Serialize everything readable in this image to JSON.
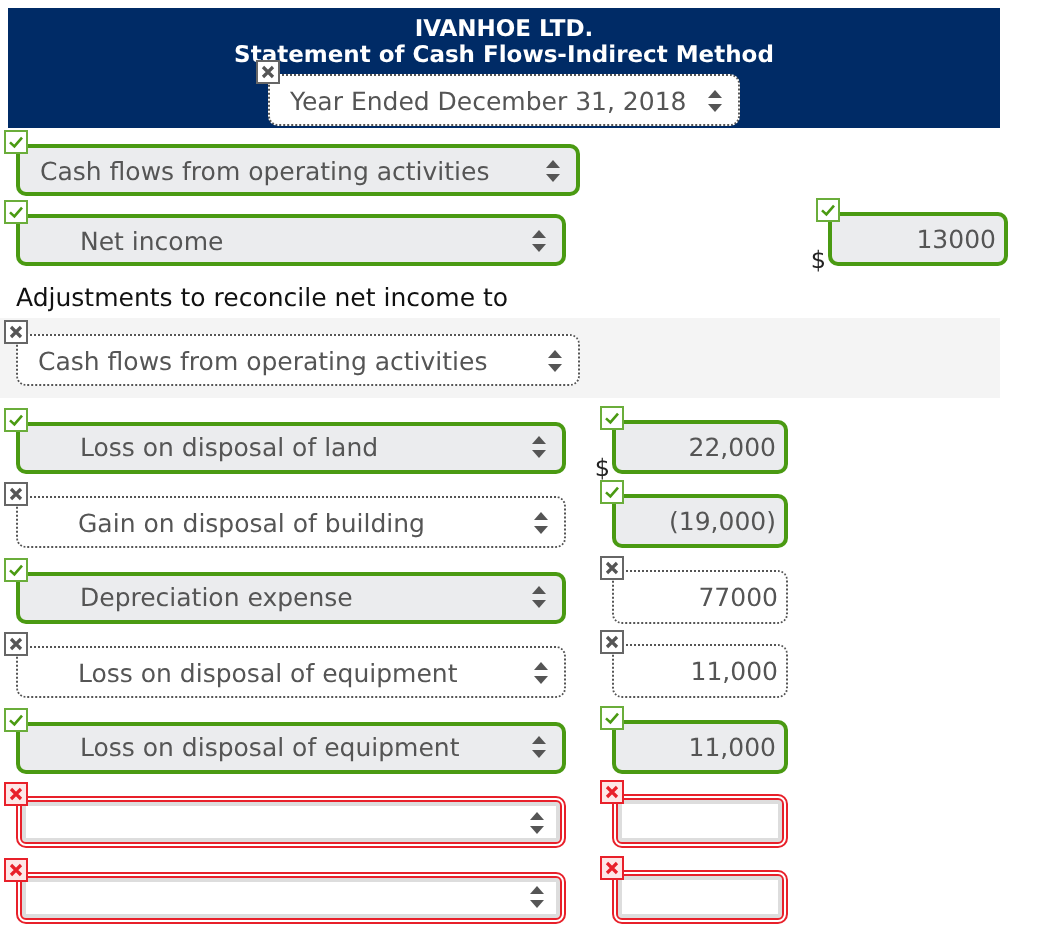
{
  "header": {
    "company": "IVANHOE LTD.",
    "statement": "Statement of Cash Flows-Indirect Method",
    "period": {
      "value": "Year Ended December 31, 2018",
      "correct": false,
      "wrong": false
    }
  },
  "rows": [
    {
      "kind": "heading",
      "label": "Cash flows from operating activities",
      "correct": true,
      "wrong": false
    },
    {
      "kind": "line",
      "label": "Net income",
      "correct": true,
      "wrong": false,
      "amount": {
        "kind": "total",
        "value": "13000",
        "currency": "$",
        "correct": true,
        "wrong": false
      }
    },
    {
      "kind": "note",
      "label": "Adjustments to reconcile net income to"
    },
    {
      "kind": "subheading",
      "label": "Cash flows from operating activities",
      "correct": false,
      "wrong": false
    },
    {
      "kind": "line",
      "label": "Loss on disposal of land",
      "correct": true,
      "wrong": false,
      "amount": {
        "kind": "item",
        "value": "22,000",
        "currency": "$",
        "correct": true,
        "wrong": false
      }
    },
    {
      "kind": "line",
      "label": "Gain on disposal of building",
      "correct": false,
      "wrong": false,
      "amount": {
        "kind": "item",
        "value": "(19,000)",
        "correct": true,
        "wrong": false
      }
    },
    {
      "kind": "line",
      "label": "Depreciation expense",
      "correct": true,
      "wrong": false,
      "amount": {
        "kind": "item",
        "value": "77000",
        "correct": false,
        "wrong": false
      }
    },
    {
      "kind": "line",
      "label": "Loss on disposal of equipment",
      "correct": false,
      "wrong": false,
      "amount": {
        "kind": "item",
        "value": "11,000",
        "correct": false,
        "wrong": false
      }
    },
    {
      "kind": "line",
      "label": "Loss on disposal of equipment",
      "correct": true,
      "wrong": false,
      "amount": {
        "kind": "item",
        "value": "11,000",
        "correct": true,
        "wrong": false
      }
    },
    {
      "kind": "line",
      "correct": false,
      "wrong": true,
      "amount": {
        "kind": "item",
        "correct": false,
        "wrong": true
      }
    },
    {
      "kind": "line",
      "correct": false,
      "wrong": true,
      "amount": {
        "kind": "item",
        "correct": false,
        "wrong": true
      }
    }
  ]
}
